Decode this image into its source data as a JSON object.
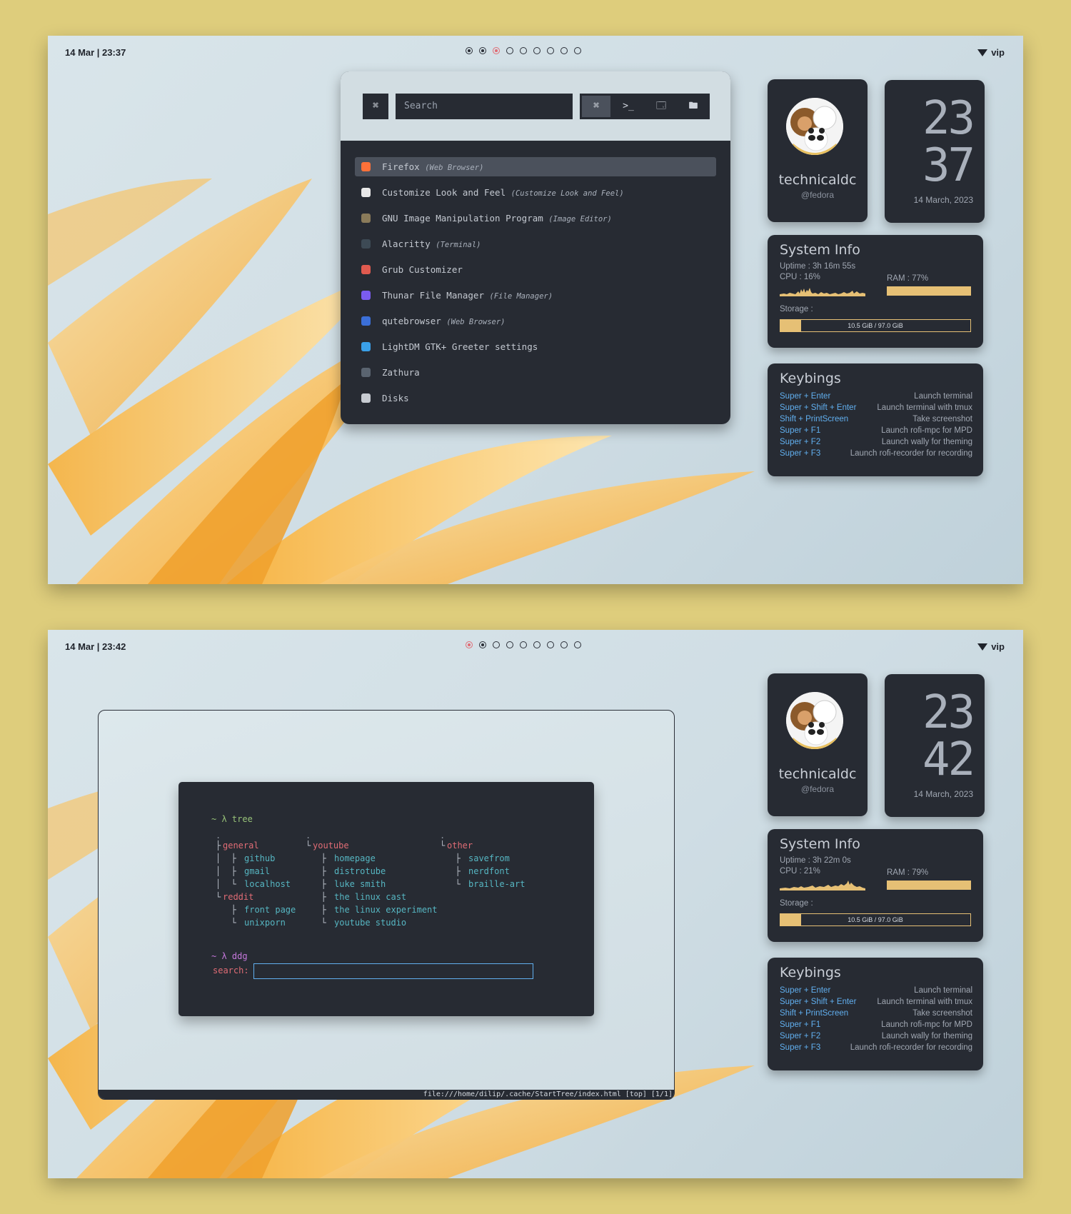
{
  "screens": [
    {
      "bar": {
        "datetime": "14 Mar | 23:37",
        "wifi": "vip",
        "active_workspace": 3
      },
      "profile": {
        "name": "technicaldc",
        "handle": "@fedora"
      },
      "clock": {
        "hour": "23",
        "minute": "37",
        "date": "14 March, 2023"
      },
      "sysinfo": {
        "title": "System Info",
        "uptime": "Uptime : 3h 16m 55s",
        "cpu": "CPU : 16%",
        "ram": "RAM : 77%",
        "ram_fraction": 0.77,
        "storage_label": "Storage :",
        "storage": "10.5 GiB / 97.0 GiB",
        "storage_fraction": 0.108
      },
      "keybinds": {
        "title": "Keybings",
        "rows": [
          {
            "keys": "Super + Enter",
            "desc": "Launch terminal"
          },
          {
            "keys": "Super + Shift + Enter",
            "desc": "Launch terminal with tmux"
          },
          {
            "keys": "Shift + PrintScreen",
            "desc": "Take screenshot"
          },
          {
            "keys": "Super + F1",
            "desc": "Launch rofi-mpc for MPD"
          },
          {
            "keys": "Super + F2",
            "desc": "Launch wally for theming"
          },
          {
            "keys": "Super + F3",
            "desc": "Launch rofi-recorder for recording"
          }
        ]
      },
      "launcher": {
        "cmd_icon": "⌘",
        "search_placeholder": "Search",
        "modes": [
          "⌘",
          ">_",
          "🗔",
          "🖿"
        ],
        "items": [
          {
            "name": "Firefox",
            "generic": "(Web Browser)",
            "color": "#ff7139"
          },
          {
            "name": "Customize Look and Feel",
            "generic": "(Customize Look and Feel)",
            "color": "#e8e8e8"
          },
          {
            "name": "GNU Image Manipulation Program",
            "generic": "(Image Editor)",
            "color": "#8a7b5a"
          },
          {
            "name": "Alacritty",
            "generic": "(Terminal)",
            "color": "#3d4a55"
          },
          {
            "name": "Grub Customizer",
            "generic": "",
            "color": "#e05a4f"
          },
          {
            "name": "Thunar File Manager",
            "generic": "(File Manager)",
            "color": "#7b5cf0"
          },
          {
            "name": "qutebrowser",
            "generic": "(Web Browser)",
            "color": "#3b6fd8"
          },
          {
            "name": "LightDM GTK+ Greeter settings",
            "generic": "",
            "color": "#3aa0e8"
          },
          {
            "name": "Zathura",
            "generic": "",
            "color": "#5a6470"
          },
          {
            "name": "Disks",
            "generic": "",
            "color": "#c8ccd2"
          }
        ]
      }
    },
    {
      "bar": {
        "datetime": "14 Mar | 23:42",
        "wifi": "vip",
        "active_workspace": 1
      },
      "profile": {
        "name": "technicaldc",
        "handle": "@fedora"
      },
      "clock": {
        "hour": "23",
        "minute": "42",
        "date": "14 March, 2023"
      },
      "sysinfo": {
        "title": "System Info",
        "uptime": "Uptime : 3h 22m 0s",
        "cpu": "CPU : 21%",
        "ram": "RAM : 79%",
        "ram_fraction": 0.79,
        "storage_label": "Storage :",
        "storage": "10.5 GiB / 97.0 GiB",
        "storage_fraction": 0.108
      },
      "keybinds": {
        "title": "Keybings",
        "rows": [
          {
            "keys": "Super + Enter",
            "desc": "Launch terminal"
          },
          {
            "keys": "Super + Shift + Enter",
            "desc": "Launch terminal with tmux"
          },
          {
            "keys": "Shift + PrintScreen",
            "desc": "Take screenshot"
          },
          {
            "keys": "Super + F1",
            "desc": "Launch rofi-mpc for MPD"
          },
          {
            "keys": "Super + F2",
            "desc": "Launch wally for theming"
          },
          {
            "keys": "Super + F3",
            "desc": "Launch rofi-recorder for recording"
          }
        ]
      },
      "browser": {
        "statusbar": "file:///home/dilip/.cache/StartTree/index.html [top] [1/1]",
        "prompt1": "~ λ tree",
        "groups": [
          {
            "name": "general",
            "links": [
              "github",
              "gmail",
              "localhost"
            ]
          },
          {
            "name": "reddit",
            "links": [
              "front page",
              "unixporn"
            ]
          },
          {
            "name": "youtube",
            "links": [
              "homepage",
              "distrotube",
              "luke smith",
              "the linux cast",
              "the linux experiment",
              "youtube studio"
            ]
          },
          {
            "name": "other",
            "links": [
              "savefrom",
              "nerdfont",
              "braille-art"
            ]
          }
        ],
        "prompt2": "~ λ ddg",
        "search_label": "search:"
      }
    }
  ],
  "colors": {
    "accent_bar": "#e6c075",
    "key_blue": "#61afef",
    "active_ws": "#e06c75",
    "card_bg": "#272b33"
  }
}
